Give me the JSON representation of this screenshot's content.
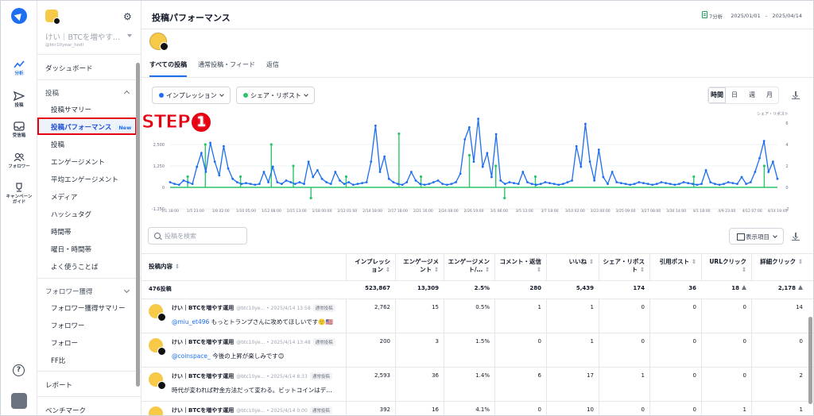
{
  "rail": {
    "items": [
      {
        "label": "分析",
        "icon": "chart-line-icon",
        "active": true
      },
      {
        "label": "投稿",
        "icon": "send-icon"
      },
      {
        "label": "受信箱",
        "icon": "inbox-icon"
      },
      {
        "label": "フォロワー",
        "icon": "users-icon"
      },
      {
        "label": "キャンペーン\nガイド",
        "icon": "trophy-icon"
      }
    ],
    "help": "?"
  },
  "sidebar": {
    "account_name": "けい｜BTCを増やす…",
    "account_handle": "@btc10year_hodl",
    "dashboard": "ダッシュボード",
    "posts_section": "投稿",
    "posts_items": [
      "投稿サマリー",
      "投稿パフォーマンス",
      "投稿",
      "エンゲージメント",
      "平均エンゲージメント",
      "メディア",
      "ハッシュタグ",
      "時間帯",
      "曜日・時間帯",
      "よく使うことば"
    ],
    "new_badge": "New",
    "followers_section": "フォロワー獲得",
    "followers_items": [
      "フォロワー獲得サマリー",
      "フォロワー",
      "フォロー",
      "FF比"
    ],
    "report": "レポート",
    "benchmark": "ベンチマーク"
  },
  "header": {
    "title": "投稿パフォーマンス",
    "export": "7分析",
    "date_from": "2025/01/01",
    "date_sep": "-",
    "date_to": "2025/04/14"
  },
  "tabs": [
    "すべての投稿",
    "通常投稿・フィード",
    "返信"
  ],
  "controls": {
    "metric1": "インプレッション",
    "metric2": "シェア・リポスト",
    "metric1_color": "#1d6ef0",
    "metric2_color": "#2ec46b",
    "periods": [
      "時間",
      "日",
      "週",
      "月"
    ],
    "active_period": "時間"
  },
  "annotation": {
    "step": "STEP",
    "num": "1"
  },
  "chart_data": {
    "type": "line",
    "right_axis_label": "シェア・リポスト",
    "left_ticks": [
      "2,500",
      "1,250",
      "0",
      "-1,250"
    ],
    "right_ticks": [
      "6",
      "4",
      "2",
      "0",
      "-2"
    ],
    "ylim_left": [
      -1250,
      3750
    ],
    "ylim_right": [
      -2,
      6
    ],
    "x_ticks": [
      "1/1 18:00",
      "1/5 23:00",
      "1/8 02:00",
      "1/10 05:00",
      "1/12 08:00",
      "1/15 13:00",
      "1/18 00:00",
      "2/12 01:00",
      "2/14 18:00",
      "2/17 18:00",
      "2/21 16:00",
      "2/24 08:00",
      "2/26 19:00",
      "3/1 06:00",
      "3/5 13:00",
      "3/7 18:00",
      "3/10 02:00",
      "3/23 00:00",
      "3/25 09:00",
      "3/27 08:00",
      "3/30 14:00",
      "4/1 18:00",
      "4/9 23:00",
      "4/12 07:00",
      "4/14 19:00"
    ],
    "series": [
      {
        "name": "インプレッション",
        "color": "#1d6ef0",
        "axis": "left",
        "values": [
          300,
          200,
          150,
          400,
          300,
          200,
          1200,
          2000,
          900,
          2600,
          1500,
          700,
          2400,
          1100,
          500,
          300,
          200,
          250,
          200,
          150,
          200,
          900,
          300,
          1200,
          300,
          200,
          400,
          300,
          200,
          300,
          200,
          1500,
          600,
          1000,
          500,
          300,
          200,
          900,
          400,
          200,
          300,
          150,
          200,
          250,
          300,
          1500,
          3600,
          900,
          1800,
          500,
          300,
          200,
          150,
          300,
          900,
          400,
          200,
          150,
          200,
          300,
          400,
          200,
          150,
          200,
          300,
          800,
          2800,
          3500,
          1500,
          4000,
          1200,
          2000,
          600,
          3100,
          400,
          200,
          300,
          250,
          200,
          900,
          300,
          200,
          150,
          200,
          300,
          250,
          200,
          150,
          200,
          300,
          400,
          2400,
          1200,
          3700,
          1500,
          400,
          2200,
          600,
          200,
          900,
          300,
          250,
          200,
          150,
          200,
          300,
          250,
          200,
          150,
          200,
          300,
          250,
          200,
          150,
          200,
          300,
          250,
          200,
          150,
          200,
          1000,
          300,
          200,
          150,
          200,
          300,
          250,
          200,
          600,
          200,
          300,
          900,
          1700,
          2700,
          900,
          1500,
          500
        ]
      },
      {
        "name": "シェア・リポスト",
        "color": "#2ec46b",
        "axis": "right",
        "values": [
          0,
          0,
          0,
          0,
          1,
          0,
          0,
          0,
          4,
          0,
          0,
          0,
          0,
          0,
          0,
          0,
          1,
          0,
          0,
          0,
          0,
          0,
          0,
          4,
          0,
          0,
          0,
          0,
          2,
          0,
          0,
          0,
          -1,
          0,
          0,
          0,
          0,
          0,
          0,
          0,
          1,
          0,
          0,
          0,
          0,
          0,
          0,
          0,
          0,
          0,
          0,
          0,
          5,
          0,
          0,
          0,
          0,
          1,
          0,
          0,
          0,
          0,
          0,
          0,
          0,
          0,
          0,
          0,
          3,
          0,
          0,
          0,
          0,
          0,
          2,
          0,
          -1,
          0,
          0,
          0,
          0,
          0,
          0,
          1,
          0,
          0,
          0,
          0,
          0,
          0,
          0,
          0,
          0,
          0,
          0,
          0,
          0,
          0,
          0,
          0,
          0,
          0,
          0,
          0,
          0,
          0,
          0,
          0,
          0,
          0,
          0,
          0,
          0,
          0,
          0,
          0,
          0,
          0,
          0,
          1,
          0,
          0,
          0,
          0,
          0,
          0,
          0,
          0,
          0,
          0,
          0,
          0,
          0,
          0,
          0,
          2,
          0,
          0,
          0
        ]
      }
    ]
  },
  "search": {
    "placeholder": "投稿を検索"
  },
  "columns_button": "表示項目",
  "table": {
    "headers": [
      "投稿内容",
      "インプレッション",
      "エンゲージメント",
      "エンゲージメント/…",
      "コメント・返信",
      "いいね",
      "シェア・リポスト",
      "引用ポスト",
      "URLクリック",
      "詳細クリック"
    ],
    "summary": {
      "label": "476投稿",
      "values": [
        "523,867",
        "13,309",
        "2.5%",
        "280",
        "5,439",
        "174",
        "36",
        "18",
        "2,178"
      ]
    },
    "rows": [
      {
        "name": "けい｜BTCを増やす運用",
        "handle": "@btc10ye...",
        "date": "2025/4/14 13:58",
        "tag": "通常投稿",
        "mention": "@miu_et496",
        "text": " もっとトランプさんに攻めてほしいです🙂🇺🇸",
        "values": [
          "2,762",
          "15",
          "0.5%",
          "1",
          "1",
          "0",
          "0",
          "0",
          "14"
        ]
      },
      {
        "name": "けい｜BTCを増やす運用",
        "handle": "@btc10ye...",
        "date": "2025/4/14 13:48",
        "tag": "通常投稿",
        "mention": "@coinspace_",
        "text": " 今後の上昇が楽しみです😊",
        "values": [
          "200",
          "3",
          "1.5%",
          "0",
          "1",
          "0",
          "0",
          "0",
          "0"
        ]
      },
      {
        "name": "けい｜BTCを増やす運用",
        "handle": "@btc10ye...",
        "date": "2025/4/14 8:33",
        "tag": "通常投稿",
        "mention": "",
        "text": "時代が変われば貯金方法だって変わる。ビットコインはデ…",
        "values": [
          "2,593",
          "36",
          "1.4%",
          "6",
          "17",
          "1",
          "0",
          "0",
          "2"
        ]
      },
      {
        "name": "けい｜BTCを増やす運用",
        "handle": "@btc10ye...",
        "date": "2025/4/14 0:00",
        "tag": "通常投稿",
        "mention": "",
        "text": "",
        "values": [
          "392",
          "16",
          "4.1%",
          "0",
          "10",
          "0",
          "0",
          "1",
          "1"
        ]
      }
    ]
  }
}
